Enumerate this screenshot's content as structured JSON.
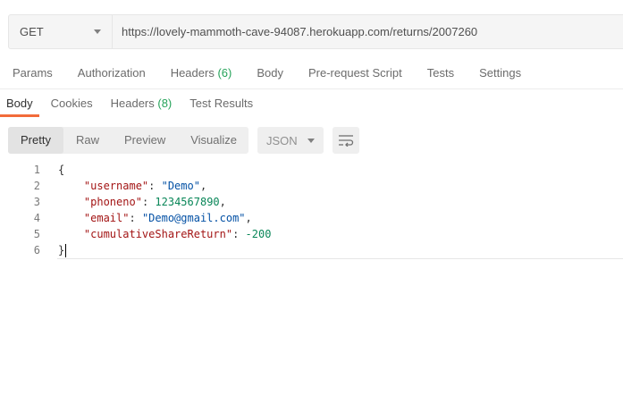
{
  "request": {
    "method": "GET",
    "url": "https://lovely-mammoth-cave-94087.herokuapp.com/returns/2007260"
  },
  "request_tabs": [
    {
      "label": "Params"
    },
    {
      "label": "Authorization"
    },
    {
      "label": "Headers",
      "count": "(6)"
    },
    {
      "label": "Body"
    },
    {
      "label": "Pre-request Script"
    },
    {
      "label": "Tests"
    },
    {
      "label": "Settings"
    }
  ],
  "response_tabs": [
    {
      "label": "Body",
      "active": true
    },
    {
      "label": "Cookies"
    },
    {
      "label": "Headers",
      "count": "(8)"
    },
    {
      "label": "Test Results"
    }
  ],
  "view_modes": [
    "Pretty",
    "Raw",
    "Preview",
    "Visualize"
  ],
  "active_view_mode": "Pretty",
  "format": "JSON",
  "wrap_icon": "wrap-lines-icon",
  "colors": {
    "accent": "#f26b3a",
    "count": "#26a35a",
    "key": "#a31515",
    "string": "#0451a5",
    "number": "#098658"
  },
  "response_body": {
    "line_numbers": [
      "1",
      "2",
      "3",
      "4",
      "5",
      "6"
    ],
    "open_brace": "{",
    "close_brace": "}",
    "fields": [
      {
        "key": "\"username\"",
        "value": "\"Demo\"",
        "type": "string",
        "comma": ","
      },
      {
        "key": "\"phoneno\"",
        "value": "1234567890",
        "type": "number",
        "comma": ","
      },
      {
        "key": "\"email\"",
        "value": "\"Demo@gmail.com\"",
        "type": "string",
        "comma": ","
      },
      {
        "key": "\"cumulativeShareReturn\"",
        "value": "-200",
        "type": "number",
        "comma": ""
      }
    ]
  }
}
